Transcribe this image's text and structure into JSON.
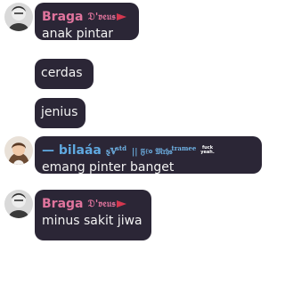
{
  "messages": [
    {
      "author": "Braga",
      "author_tag": "𝔇'𝔳𝔢𝔲𝔰",
      "lines": [
        "anak pintar",
        "cerdas",
        "jenius"
      ]
    },
    {
      "author": "— bilaáa",
      "author_tag": "ȿ𝕍",
      "author_tag_sup": "std",
      "author_tag_extra": "|| 𝔉ℓ० 𝔐𝔯𝔥𝔰",
      "author_tag_extra_sup": "tramee",
      "author_tag_fine": [
        "fuck",
        "yeah."
      ],
      "lines": [
        "emang pinter banget"
      ]
    },
    {
      "author": "Braga",
      "author_tag": "𝔇'𝔳𝔢𝔲𝔰",
      "lines": [
        "minus sakit jiwa"
      ]
    }
  ],
  "colors": {
    "bubble": "#2b2636",
    "braga_name": "#e0749d",
    "bilaa_name": "#5fa8df",
    "text": "#f2f2f2"
  }
}
